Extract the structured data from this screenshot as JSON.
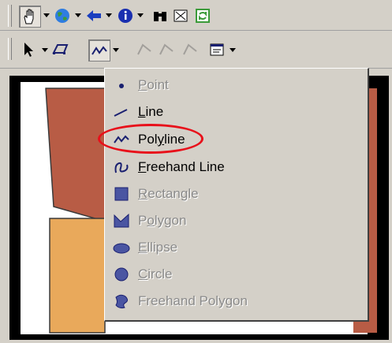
{
  "toolbar_top": {
    "items": [
      {
        "name": "pan-tool-icon"
      },
      {
        "name": "globe-icon"
      },
      {
        "name": "back-arrow-icon"
      },
      {
        "name": "info-icon"
      },
      {
        "name": "binoculars-icon"
      },
      {
        "name": "zoom-extent-icon"
      },
      {
        "name": "refresh-icon"
      }
    ]
  },
  "toolbar_draw": {
    "items": [
      {
        "name": "select-arrow-icon"
      },
      {
        "name": "draw-shape-icon"
      },
      {
        "name": "polyline-icon"
      }
    ]
  },
  "menu": {
    "items": [
      {
        "label": "Point",
        "accel": "P",
        "enabled": false,
        "icon": "point-icon"
      },
      {
        "label": "Line",
        "accel": "L",
        "enabled": true,
        "icon": "line-icon"
      },
      {
        "label": "Polyline",
        "accel": "y",
        "enabled": true,
        "icon": "polyline-icon"
      },
      {
        "label": "Freehand Line",
        "accel": "F",
        "enabled": true,
        "icon": "freehand-line-icon"
      },
      {
        "label": "Rectangle",
        "accel": "R",
        "enabled": false,
        "icon": "rectangle-icon"
      },
      {
        "label": "Polygon",
        "accel": "o",
        "enabled": false,
        "icon": "polygon-icon"
      },
      {
        "label": "Ellipse",
        "accel": "E",
        "enabled": false,
        "icon": "ellipse-icon"
      },
      {
        "label": "Circle",
        "accel": "C",
        "enabled": false,
        "icon": "circle-icon"
      },
      {
        "label": "Freehand Polygon",
        "accel": "",
        "enabled": false,
        "icon": "freehand-polygon-icon"
      }
    ]
  },
  "colors": {
    "ui_face": "#d4d0c8",
    "map_brown": "#b85c45",
    "map_tan": "#e9a95b",
    "highlight": "#e8101a",
    "shape_blue": "#4a55a2"
  }
}
